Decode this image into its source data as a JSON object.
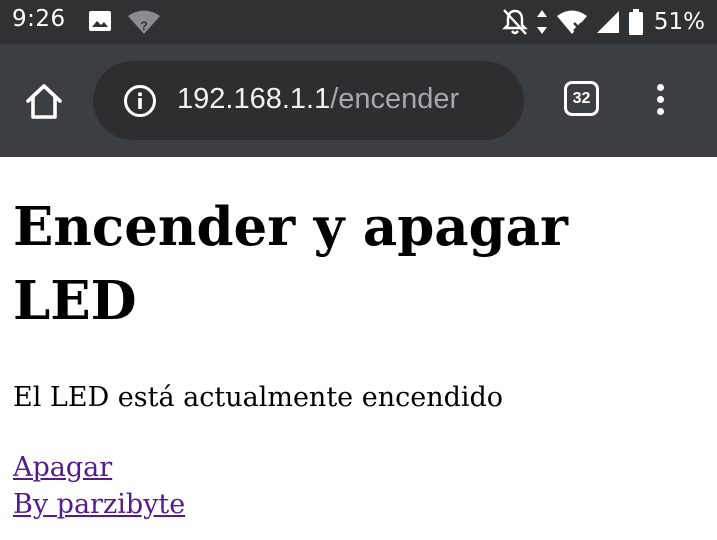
{
  "status_bar": {
    "time": "9:26",
    "wifi_badge": "?",
    "battery_percent": "51%",
    "icons": [
      "image-icon",
      "wifi-question-icon",
      "notifications-off-icon",
      "data-arrows-icon",
      "wifi-x-icon",
      "cell-signal-icon",
      "battery-icon"
    ]
  },
  "browser": {
    "url_host": "192.168.1.1",
    "url_path": "/encender",
    "tab_count": "32",
    "icons": [
      "home-icon",
      "info-icon",
      "tabs-icon",
      "more-vert-icon"
    ]
  },
  "page": {
    "title": "Encender y apagar LED",
    "status_text": "El LED está actualmente encendido",
    "links": [
      "Apagar",
      "By parzibyte"
    ]
  },
  "colors": {
    "status_bar_bg": "#2f3133",
    "toolbar_bg": "#3c3f41",
    "url_pill_bg": "#2c2e30",
    "visited_link": "#551a8b"
  }
}
